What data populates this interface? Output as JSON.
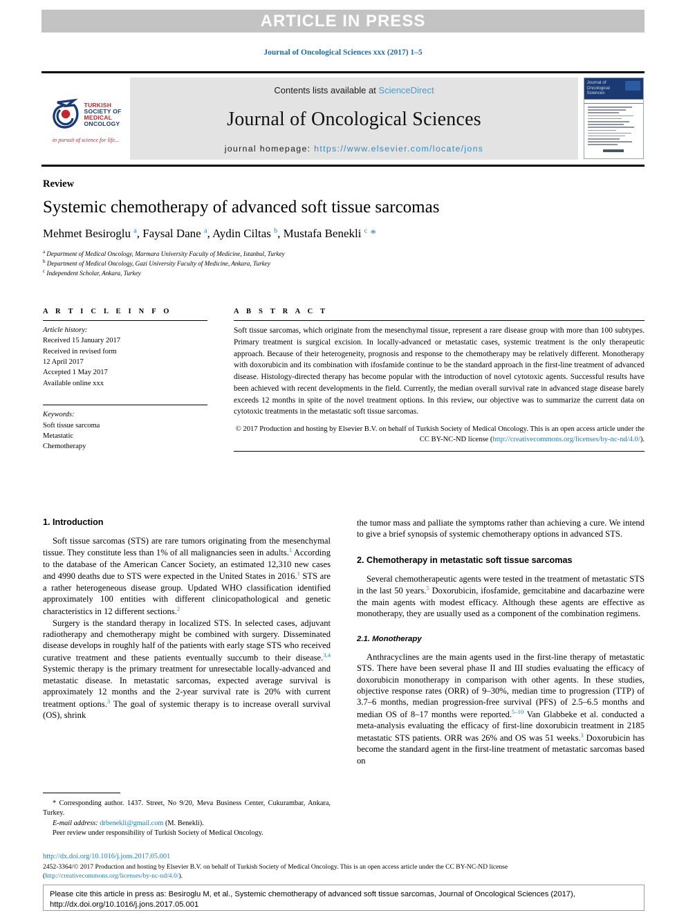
{
  "banner": {
    "text": "ARTICLE IN PRESS"
  },
  "running_head": {
    "text": "Journal of Oncological Sciences xxx (2017) 1–5"
  },
  "masthead": {
    "logo": {
      "words": [
        "TURKISH",
        "SOCIETY OF",
        "MEDICAL",
        "ONCOLOGY"
      ],
      "tagline": "in pursuit of science for life..."
    },
    "contents_prefix": "Contents lists available at ",
    "contents_link": "ScienceDirect",
    "journal_title": "Journal of Oncological Sciences",
    "homepage_prefix": "journal homepage: ",
    "homepage_link": "https://www.elsevier.com/locate/jons",
    "cover_title_lines": [
      "Journal of",
      "Oncological",
      "Sciences"
    ]
  },
  "article": {
    "type_label": "Review",
    "title": "Systemic chemotherapy of advanced soft tissue sarcomas",
    "authors_html": "Mehmet Besiroglu <sup>a</sup>, Faysal Dane <sup>a</sup>, Aydin Ciltas <sup>b</sup>, Mustafa Benekli <sup>c</sup> <span class=\"star\">*</span>",
    "affiliations": [
      "a Department of Medical Oncology, Marmara University Faculty of Medicine, Istanbul, Turkey",
      "b Department of Medical Oncology, Gazi University Faculty of Medicine, Ankara, Turkey",
      "c Independent Scholar, Ankara, Turkey"
    ]
  },
  "article_info": {
    "heading": "A R T I C L E  I N F O",
    "history_label": "Article history:",
    "history": [
      "Received 15 January 2017",
      "Received in revised form",
      "12 April 2017",
      "Accepted 1 May 2017",
      "Available online xxx"
    ],
    "keywords_label": "Keywords:",
    "keywords": [
      "Soft tissue sarcoma",
      "Metastatic",
      "Chemotherapy"
    ]
  },
  "abstract": {
    "heading": "A B S T R A C T",
    "body": "Soft tissue sarcomas, which originate from the mesenchymal tissue, represent a rare disease group with more than 100 subtypes. Primary treatment is surgical excision. In locally-advanced or metastatic cases, systemic treatment is the only therapeutic approach. Because of their heterogeneity, prognosis and response to the chemotherapy may be relatively different. Monotherapy with doxorubicin and its combination with ifosfamide continue to be the standard approach in the first-line treatment of advanced disease. Histology-directed therapy has become popular with the introduction of novel cytotoxic agents. Successful results have been achieved with recent developments in the field. Currently, the median overall survival rate in advanced stage disease barely exceeds 12 months in spite of the novel treatment options. In this review, our objective was to summarize the current data on cytotoxic treatments in the metastatic soft tissue sarcomas.",
    "copyright_text": "© 2017 Production and hosting by Elsevier B.V. on behalf of Turkish Society of Medical Oncology. This is an open access article under the CC BY-NC-ND license (",
    "copyright_link": "http://creativecommons.org/licenses/by-nc-nd/4.0/",
    "copyright_suffix": ")."
  },
  "body": {
    "left": {
      "h_intro": "1. Introduction",
      "p1_html": "Soft tissue sarcomas (STS) are rare tumors originating from the mesenchymal tissue. They constitute less than 1% of all malignancies seen in adults.<sup>1</sup> According to the database of the American Cancer Society, an estimated 12,310 new cases and 4990 deaths due to STS were expected in the United States in 2016.<sup>1</sup> STS are a rather heterogeneous disease group. Updated WHO classification identified approximately 100 entities with different clinicopathological and genetic characteristics in 12 different sections.<sup>2</sup>",
      "p2_html": "Surgery is the standard therapy in localized STS. In selected cases, adjuvant radiotherapy and chemotherapy might be combined with surgery. Disseminated disease develops in roughly half of the patients with early stage STS who received curative treatment and these patients eventually succumb to their disease.<sup>3,4</sup> Systemic therapy is the primary treatment for unresectable locally-advanced and metastatic disease. In metastatic sarcomas, expected average survival is approximately 12 months and the 2-year survival rate is 20% with current treatment options.<sup>3</sup> The goal of systemic therapy is to increase overall survival (OS), shrink"
    },
    "right": {
      "p1_html": "the tumor mass and palliate the symptoms rather than achieving a cure. We intend to give a brief synopsis of systemic chemotherapy options in advanced STS.",
      "h_chemo": "2. Chemotherapy in metastatic soft tissue sarcomas",
      "p2_html": "Several chemotherapeutic agents were tested in the treatment of metastatic STS in the last 50 years.<sup>5</sup> Doxorubicin, ifosfamide, gemcitabine and dacarbazine were the main agents with modest efficacy. Although these agents are effective as monotherapy, they are usually used as a component of the combination regimens.",
      "h_mono": "2.1. Monotherapy",
      "p3_html": "Anthracyclines are the main agents used in the first-line therapy of metastatic STS. There have been several phase II and III studies evaluating the efficacy of doxorubicin monotherapy in comparison with other agents. In these studies, objective response rates (ORR) of 9–30%, median time to progression (TTP) of 3.7–6 months, median progression-free survival (PFS) of 2.5–6.5 months and median OS of 8–17 months were reported.<sup>5–10</sup> Van Glabbeke et al. conducted a meta-analysis evaluating the efficacy of first-line doxorubicin treatment in 2185 metastatic STS patients. ORR was 26% and OS was 51 weeks.<sup>3</sup> Doxorubicin has become the standard agent in the first-line treatment of metastatic sarcomas based on"
    }
  },
  "footnote": {
    "corresponding_html": "* Corresponding author. 1437. Street, No 9/20, Meva Business Center, Cukurambar, Ankara, Turkey.",
    "email_label": "E-mail address:",
    "email": "drbenekli@gmail.com",
    "email_suffix": "(M. Benekli).",
    "peer_review": "Peer review under responsibility of Turkish Society of Medical Oncology."
  },
  "bottom": {
    "doi": "http://dx.doi.org/10.1016/j.jons.2017.05.001",
    "issn_text": "2452-3364/© 2017 Production and hosting by Elsevier B.V. on behalf of Turkish Society of Medical Oncology. This is an open access article under the CC BY-NC-ND license",
    "issn_link_open": "(",
    "issn_link": "http://creativecommons.org/licenses/by-nc-nd/4.0/",
    "issn_link_close": ")."
  },
  "cite_box": {
    "text": "Please cite this article in press as: Besiroglu M, et al., Systemic chemotherapy of advanced soft tissue sarcomas, Journal of Oncological Sciences (2017), http://dx.doi.org/10.1016/j.jons.2017.05.001"
  },
  "colors": {
    "link_blue": "#1b7fbf",
    "sciencedirect_blue": "#3f9fd4",
    "homepage_blue": "#2d8ec4",
    "banner_gray": "#c3c3c3",
    "masthead_gray": "#e3e3e3",
    "logo_red": "#c1272d",
    "logo_blue": "#1b3a73"
  }
}
